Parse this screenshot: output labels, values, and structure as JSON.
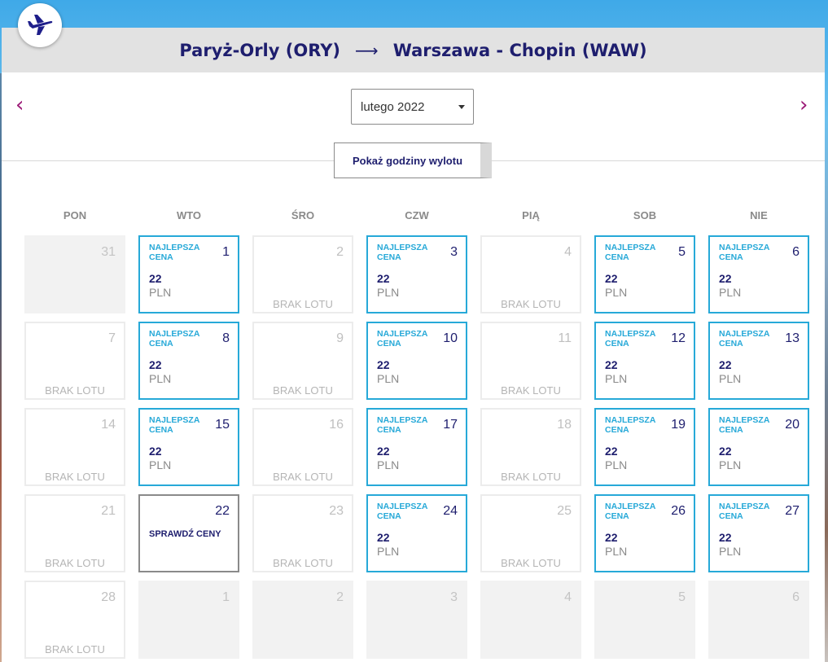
{
  "header": {
    "origin": "Paryż-Orly (ORY)",
    "arrow": "⟶",
    "destination": "Warszawa - Chopin (WAW)"
  },
  "nav": {
    "prev": "‹",
    "next": "›"
  },
  "month_select": {
    "value": "lutego 2022"
  },
  "show_hours_label": "Pokaż godziny wylotu",
  "weekdays": [
    "PON",
    "WTO",
    "ŚRO",
    "CZW",
    "PIĄ",
    "SOB",
    "NIE"
  ],
  "labels": {
    "best_price": "NAJLEPSZA CENA",
    "currency": "PLN",
    "no_flight": "BRAK LOTU",
    "check_prices": "SPRAWDŹ CENY"
  },
  "colors": {
    "brand_navy": "#1e1e6e",
    "accent_cyan": "#27a9d8",
    "nav_arrow": "#9c1a77"
  },
  "weeks": [
    [
      {
        "day": "31",
        "status": "muted"
      },
      {
        "day": "1",
        "status": "price",
        "price": "22"
      },
      {
        "day": "2",
        "status": "noflight"
      },
      {
        "day": "3",
        "status": "price",
        "price": "22"
      },
      {
        "day": "4",
        "status": "noflight"
      },
      {
        "day": "5",
        "status": "price",
        "price": "22"
      },
      {
        "day": "6",
        "status": "price",
        "price": "22"
      }
    ],
    [
      {
        "day": "7",
        "status": "noflight"
      },
      {
        "day": "8",
        "status": "price",
        "price": "22"
      },
      {
        "day": "9",
        "status": "noflight"
      },
      {
        "day": "10",
        "status": "price",
        "price": "22"
      },
      {
        "day": "11",
        "status": "noflight"
      },
      {
        "day": "12",
        "status": "price",
        "price": "22"
      },
      {
        "day": "13",
        "status": "price",
        "price": "22"
      }
    ],
    [
      {
        "day": "14",
        "status": "noflight"
      },
      {
        "day": "15",
        "status": "price",
        "price": "22"
      },
      {
        "day": "16",
        "status": "noflight"
      },
      {
        "day": "17",
        "status": "price",
        "price": "22"
      },
      {
        "day": "18",
        "status": "noflight"
      },
      {
        "day": "19",
        "status": "price",
        "price": "22"
      },
      {
        "day": "20",
        "status": "price",
        "price": "22"
      }
    ],
    [
      {
        "day": "21",
        "status": "noflight"
      },
      {
        "day": "22",
        "status": "check"
      },
      {
        "day": "23",
        "status": "noflight"
      },
      {
        "day": "24",
        "status": "price",
        "price": "22"
      },
      {
        "day": "25",
        "status": "noflight"
      },
      {
        "day": "26",
        "status": "price",
        "price": "22"
      },
      {
        "day": "27",
        "status": "price",
        "price": "22"
      }
    ],
    [
      {
        "day": "28",
        "status": "noflight"
      },
      {
        "day": "1",
        "status": "muted"
      },
      {
        "day": "2",
        "status": "muted"
      },
      {
        "day": "3",
        "status": "muted"
      },
      {
        "day": "4",
        "status": "muted"
      },
      {
        "day": "5",
        "status": "muted"
      },
      {
        "day": "6",
        "status": "muted"
      }
    ]
  ]
}
